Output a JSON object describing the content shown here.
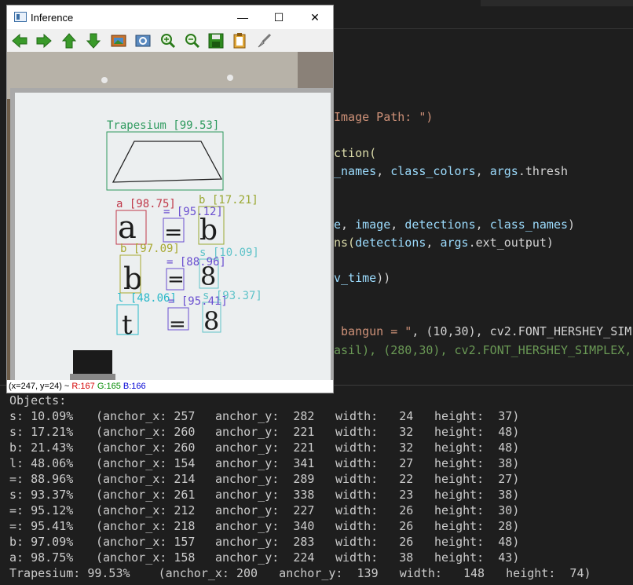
{
  "editor": {
    "lines": [
      {
        "parts": [
          {
            "t": "Image Path: \")",
            "c": "c-str"
          }
        ]
      },
      {
        "parts": [
          {
            "t": "ction(",
            "c": "c-fn"
          }
        ]
      },
      {
        "parts": [
          {
            "t": "_names",
            "c": "c-var"
          },
          {
            "t": ", ",
            "c": ""
          },
          {
            "t": "class_colors",
            "c": "c-var"
          },
          {
            "t": ", ",
            "c": ""
          },
          {
            "t": "args",
            "c": "c-var"
          },
          {
            "t": ".thresh",
            "c": ""
          }
        ]
      },
      {
        "parts": [
          {
            "t": "e",
            "c": "c-var"
          },
          {
            "t": ", ",
            "c": ""
          },
          {
            "t": "image",
            "c": "c-var"
          },
          {
            "t": ", ",
            "c": ""
          },
          {
            "t": "detections",
            "c": "c-var"
          },
          {
            "t": ", ",
            "c": ""
          },
          {
            "t": "class_names",
            "c": "c-var"
          },
          {
            "t": ")",
            "c": ""
          }
        ]
      },
      {
        "parts": [
          {
            "t": "ns(",
            "c": "c-fn"
          },
          {
            "t": "detections",
            "c": "c-var"
          },
          {
            "t": ", ",
            "c": ""
          },
          {
            "t": "args",
            "c": "c-var"
          },
          {
            "t": ".ext_output)",
            "c": ""
          }
        ]
      },
      {
        "parts": [
          {
            "t": "v_time",
            "c": "c-var"
          },
          {
            "t": "))",
            "c": ""
          }
        ]
      },
      {
        "parts": [
          {
            "t": " bangun = \"",
            "c": "c-str"
          },
          {
            "t": ", (10,30), cv2.FONT_HERSHEY_SIM",
            "c": ""
          }
        ]
      },
      {
        "parts": [
          {
            "t": "asil), (280,30), cv2.FONT_HERSHEY_SIMPLEX,",
            "c": "c-grn"
          }
        ]
      }
    ]
  },
  "window": {
    "title": "Inference",
    "minimize": "—",
    "maximize": "☐",
    "close": "✕",
    "toolbar": [
      {
        "name": "back-arrow-icon"
      },
      {
        "name": "forward-arrow-icon"
      },
      {
        "name": "up-arrow-icon"
      },
      {
        "name": "down-arrow-icon"
      },
      {
        "name": "image-icon"
      },
      {
        "name": "zoom-region-icon"
      },
      {
        "name": "zoom-in-icon"
      },
      {
        "name": "zoom-out-icon"
      },
      {
        "name": "save-icon"
      },
      {
        "name": "clipboard-icon"
      },
      {
        "name": "brush-icon"
      }
    ],
    "status": {
      "coords": "(x=247, y=24) ~ ",
      "r": "R:167",
      "g": "G:165",
      "b": "B:166"
    },
    "detections": [
      {
        "label": "Trapesium [99.53]",
        "color": "#2e9a5e"
      },
      {
        "label": "a [98.75]",
        "color": "#c0394a"
      },
      {
        "label": "b [17.21]",
        "color": "#9aa832"
      },
      {
        "label": "= [95.12]",
        "color": "#6a4fd0"
      },
      {
        "label": "b [97.09]",
        "color": "#a8a830"
      },
      {
        "label": "= [88.96]",
        "color": "#6a4fd0"
      },
      {
        "label": "s [10.09]",
        "color": "#5fc3c9"
      },
      {
        "label": "l [48.06]",
        "color": "#28b8c8"
      },
      {
        "label": "= [95.41]",
        "color": "#6a4fd0"
      },
      {
        "label": "s [93.37]",
        "color": "#5fc3c9"
      }
    ]
  },
  "terminal": {
    "header": "Objects:",
    "rows": [
      {
        "cls": "s: 10.09%",
        "ax": "(anchor_x: 257",
        "ay": "anchor_y:  282",
        "w": "width:   24",
        "h": "height:  37)"
      },
      {
        "cls": "s: 17.21%",
        "ax": "(anchor_x: 260",
        "ay": "anchor_y:  221",
        "w": "width:   32",
        "h": "height:  48)"
      },
      {
        "cls": "b: 21.43%",
        "ax": "(anchor_x: 260",
        "ay": "anchor_y:  221",
        "w": "width:   32",
        "h": "height:  48)"
      },
      {
        "cls": "l: 48.06%",
        "ax": "(anchor_x: 154",
        "ay": "anchor_y:  341",
        "w": "width:   27",
        "h": "height:  38)"
      },
      {
        "cls": "=: 88.96%",
        "ax": "(anchor_x: 214",
        "ay": "anchor_y:  289",
        "w": "width:   22",
        "h": "height:  27)"
      },
      {
        "cls": "s: 93.37%",
        "ax": "(anchor_x: 261",
        "ay": "anchor_y:  338",
        "w": "width:   23",
        "h": "height:  38)"
      },
      {
        "cls": "=: 95.12%",
        "ax": "(anchor_x: 212",
        "ay": "anchor_y:  227",
        "w": "width:   26",
        "h": "height:  30)"
      },
      {
        "cls": "=: 95.41%",
        "ax": "(anchor_x: 218",
        "ay": "anchor_y:  340",
        "w": "width:   26",
        "h": "height:  28)"
      },
      {
        "cls": "b: 97.09%",
        "ax": "(anchor_x: 157",
        "ay": "anchor_y:  283",
        "w": "width:   26",
        "h": "height:  48)"
      },
      {
        "cls": "a: 98.75%",
        "ax": "(anchor_x: 158",
        "ay": "anchor_y:  224",
        "w": "width:   38",
        "h": "height:  43)"
      }
    ],
    "last": "Trapesium: 99.53%    (anchor_x: 200   anchor_y:  139   width:   148   height:  74)"
  }
}
